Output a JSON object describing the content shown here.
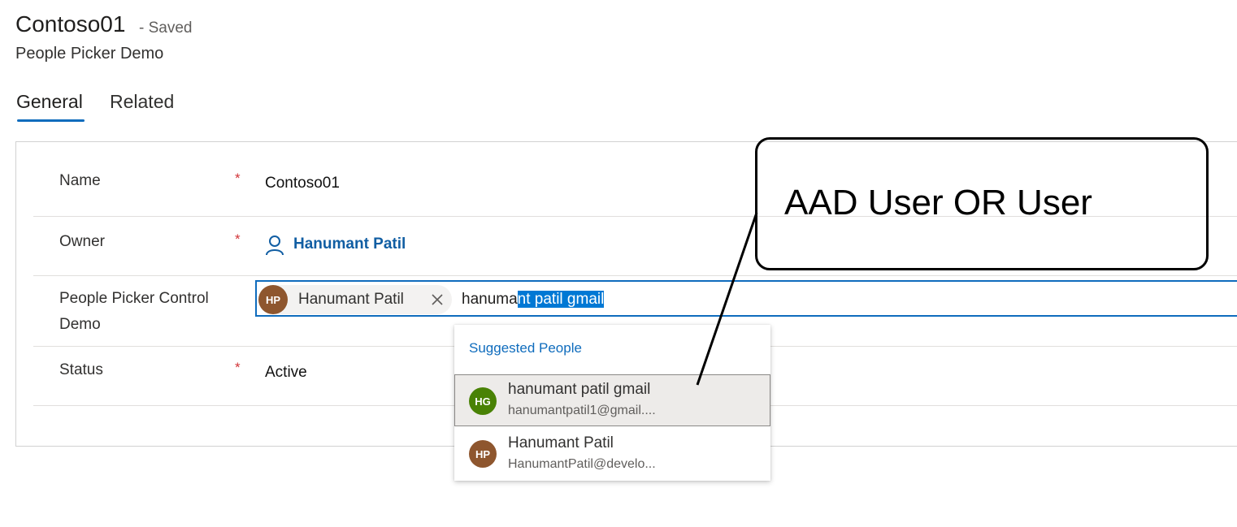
{
  "header": {
    "record_title": "Contoso01",
    "saved_status": "- Saved",
    "entity_name": "People Picker Demo"
  },
  "tabs": [
    {
      "label": "General",
      "active": true
    },
    {
      "label": "Related",
      "active": false
    }
  ],
  "form": {
    "required_marker": "*",
    "fields": {
      "name": {
        "label": "Name",
        "value": "Contoso01",
        "required": true
      },
      "owner": {
        "label": "Owner",
        "value": "Hanumant Patil",
        "icon": "person-icon",
        "required": true
      },
      "people_picker": {
        "label_line1": "People Picker Control",
        "label_line2": "Demo",
        "selected_persona": {
          "initials": "HP",
          "name": "Hanumant Patil",
          "color": "#8e562e"
        },
        "search_text_unselected": "hanuma",
        "search_text_selected": "nt patil gmail"
      },
      "status": {
        "label": "Status",
        "value": "Active",
        "required": true
      }
    }
  },
  "suggestions": {
    "header": "Suggested People",
    "items": [
      {
        "initials": "HG",
        "name": "hanumant patil gmail",
        "email": "hanumantpatil1@gmail....",
        "color": "#498205",
        "hovered": true
      },
      {
        "initials": "HP",
        "name": "Hanumant Patil",
        "email": "HanumantPatil@develo...",
        "color": "#8e562e",
        "hovered": false
      }
    ]
  },
  "callout": {
    "text": "AAD User OR User"
  },
  "colors": {
    "accent": "#0f6cbd",
    "required": "#d13438",
    "link": "#115ea3",
    "selection": "#0078d4"
  }
}
